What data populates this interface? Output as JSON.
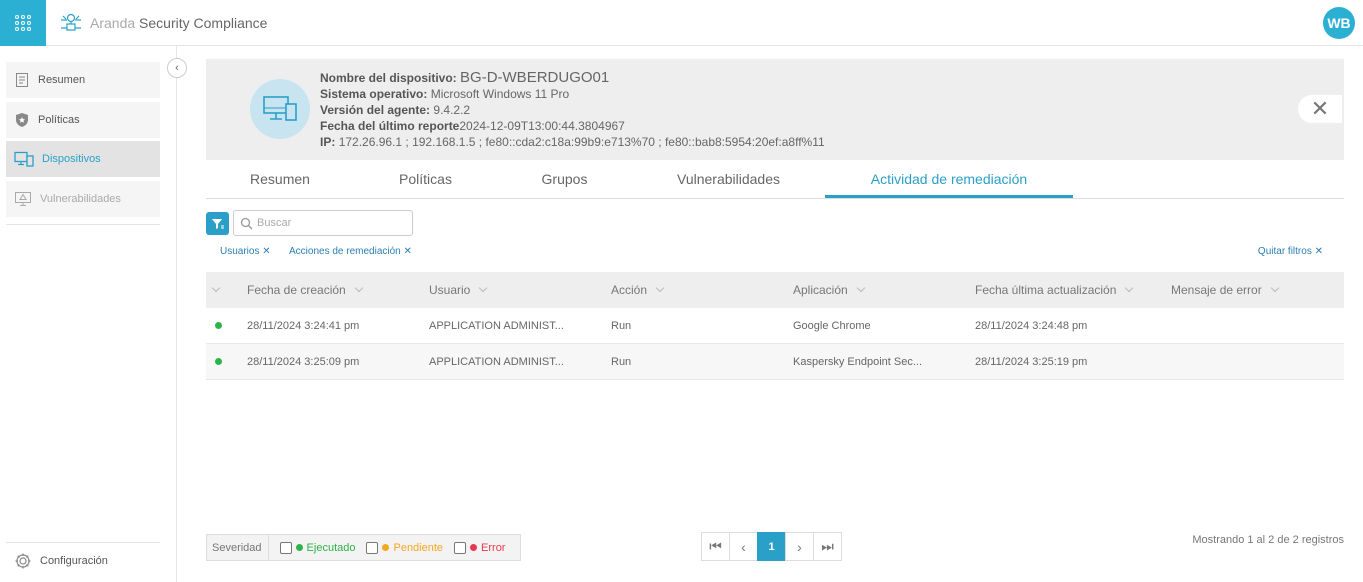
{
  "app": {
    "brand": "Aranda",
    "product": "Security Compliance",
    "user_initials": "WB"
  },
  "sidebar": {
    "items": [
      {
        "label": "Resumen",
        "icon": "report-icon"
      },
      {
        "label": "Políticas",
        "icon": "shield-icon"
      },
      {
        "label": "Dispositivos",
        "icon": "devices-icon"
      },
      {
        "label": "Vulnerabilidades",
        "icon": "monitor-warning-icon"
      }
    ],
    "config_label": "Configuración"
  },
  "device": {
    "name_label": "Nombre del dispositivo:",
    "name": "BG-D-WBERDUGO01",
    "os_label": "Sistema operativo:",
    "os": "Microsoft Windows 11 Pro",
    "agent_label": "Versión del agente:",
    "agent": "9.4.2.2",
    "report_label": "Fecha del último reporte",
    "report": "2024-12-09T13:00:44.3804967",
    "ip_label": "IP:",
    "ip": "172.26.96.1 ; 192.168.1.5 ; fe80::cda2:c18a:99b9:e713%70 ; fe80::bab8:5954:20ef:a8ff%11"
  },
  "tabs": [
    {
      "label": "Resumen"
    },
    {
      "label": "Políticas"
    },
    {
      "label": "Grupos"
    },
    {
      "label": "Vulnerabilidades"
    },
    {
      "label": "Actividad de remediación"
    }
  ],
  "search": {
    "placeholder": "Buscar"
  },
  "filters": {
    "chip_users": "Usuarios",
    "chip_actions": "Acciones de remediación",
    "clear": "Quitar filtros"
  },
  "table": {
    "headers": [
      "Fecha de creación",
      "Usuario",
      "Acción",
      "Aplicación",
      "Fecha última actualización",
      "Mensaje de error"
    ],
    "rows": [
      {
        "created": "28/11/2024 3:24:41 pm",
        "user": "APPLICATION ADMINIST...",
        "action": "Run",
        "app": "Google Chrome",
        "updated": "28/11/2024 3:24:48 pm",
        "error": "",
        "status_color": "#2db34a"
      },
      {
        "created": "28/11/2024 3:25:09 pm",
        "user": "APPLICATION ADMINIST...",
        "action": "Run",
        "app": "Kaspersky Endpoint Sec...",
        "updated": "28/11/2024 3:25:19 pm",
        "error": "",
        "status_color": "#2db34a"
      }
    ]
  },
  "severity": {
    "label": "Severidad",
    "options": [
      {
        "label": "Ejecutado",
        "color": "#2db34a"
      },
      {
        "label": "Pendiente",
        "color": "#f5a623"
      },
      {
        "label": "Error",
        "color": "#e8384f"
      }
    ]
  },
  "pagination": {
    "current": "1",
    "summary": "Mostrando 1 al 2 de 2 registros"
  },
  "colors": {
    "accent": "#2aa0c8",
    "brand": "#2bb0d4"
  }
}
